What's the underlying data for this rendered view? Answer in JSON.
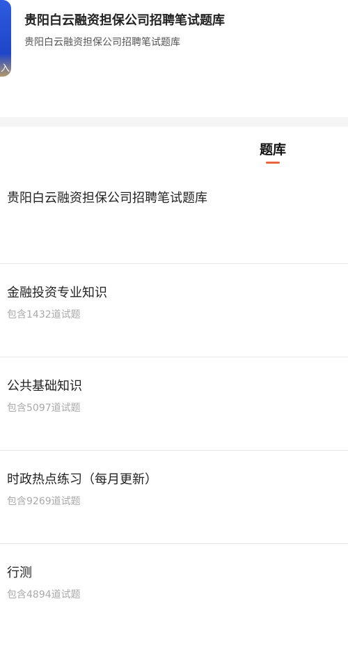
{
  "header": {
    "thumbnail_tag": "入",
    "title": "贵阳白云融资担保公司招聘笔试题库",
    "subtitle": "贵阳白云融资担保公司招聘笔试题库"
  },
  "tabs": [
    {
      "label": "题库",
      "active": true
    }
  ],
  "colors": {
    "accent": "#e8643c",
    "thumb_blue": "#2e5ce0"
  },
  "section": {
    "title": "贵阳白云融资担保公司招聘笔试题库"
  },
  "items": [
    {
      "title": "金融投资专业知识",
      "subtitle": "包含1432道试题"
    },
    {
      "title": "公共基础知识",
      "subtitle": "包含5097道试题"
    },
    {
      "title": "时政热点练习（每月更新）",
      "subtitle": "包含9269道试题"
    },
    {
      "title": "行测",
      "subtitle": "包含4894道试题"
    }
  ]
}
